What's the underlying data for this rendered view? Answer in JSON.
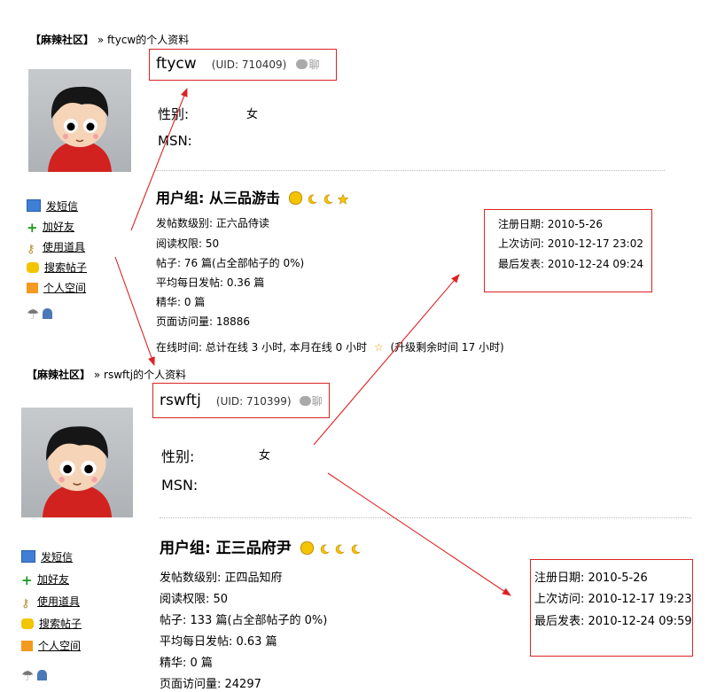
{
  "profiles": [
    {
      "crumb_site": "【麻辣社区】",
      "crumb_sep": "»",
      "crumb_page": "ftycw的个人资料",
      "username": "ftycw",
      "uid": "(UID: 710409)",
      "chat": "聊",
      "gender_label": "性别:",
      "gender_value": "女",
      "msn_label": "MSN:",
      "group_title": "用户组: 从三品游击",
      "stats": [
        "发帖数级别: 正六品侍读",
        "阅读权限: 50",
        "帖子: 76 篇(占全部帖子的 0%)",
        "平均每日发帖: 0.36 篇",
        "精华: 0 篇",
        "页面访问量: 18886"
      ],
      "online": "在线时间: 总计在线  3 小时, 本月在线  0 小时",
      "online_tail": "(升级剩余时间  17 小时)",
      "menu": [
        "发短信",
        "加好友",
        "使用道具",
        "搜索帖子",
        "个人空间"
      ],
      "dates": [
        "注册日期: 2010-5-26",
        "上次访问: 2010-12-17 23:02",
        "最后发表: 2010-12-24 09:24"
      ]
    },
    {
      "crumb_site": "【麻辣社区】",
      "crumb_sep": "»",
      "crumb_page": "rswftj的个人资料",
      "username": "rswftj",
      "uid": "(UID: 710399)",
      "chat": "聊",
      "gender_label": "性别:",
      "gender_value": "女",
      "msn_label": "MSN:",
      "group_title": "用户组: 正三品府尹",
      "stats": [
        "发帖数级别: 正四品知府",
        "阅读权限: 50",
        "帖子: 133 篇(占全部帖子的 0%)",
        "平均每日发帖: 0.63 篇",
        "精华: 0 篇",
        "页面访问量: 24297"
      ],
      "menu": [
        "发短信",
        "加好友",
        "使用道具",
        "搜索帖子",
        "个人空间"
      ],
      "dates": [
        "注册日期: 2010-5-26",
        "上次访问: 2010-12-17 19:23",
        "最后发表: 2010-12-24 09:59"
      ]
    }
  ],
  "colors": {
    "annotation": "#dd2222",
    "link": "#000000",
    "badge": "#f5c400"
  }
}
